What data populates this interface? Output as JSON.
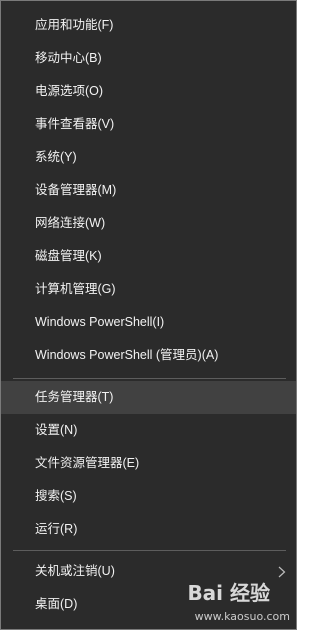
{
  "menu": {
    "group1": [
      {
        "label": "应用和功能(F)"
      },
      {
        "label": "移动中心(B)"
      },
      {
        "label": "电源选项(O)"
      },
      {
        "label": "事件查看器(V)"
      },
      {
        "label": "系统(Y)"
      },
      {
        "label": "设备管理器(M)"
      },
      {
        "label": "网络连接(W)"
      },
      {
        "label": "磁盘管理(K)"
      },
      {
        "label": "计算机管理(G)"
      },
      {
        "label": "Windows PowerShell(I)"
      },
      {
        "label": "Windows PowerShell (管理员)(A)"
      }
    ],
    "group2": [
      {
        "label": "任务管理器(T)",
        "highlighted": true
      },
      {
        "label": "设置(N)"
      },
      {
        "label": "文件资源管理器(E)"
      },
      {
        "label": "搜索(S)"
      },
      {
        "label": "运行(R)"
      }
    ],
    "group3": [
      {
        "label": "关机或注销(U)",
        "icon": "chevron-right-icon"
      },
      {
        "label": "桌面(D)"
      }
    ]
  },
  "watermark": {
    "logo": "Bai 经验",
    "url": "www.kaosuo.com"
  },
  "colors": {
    "background": "#2b2b2b",
    "highlight": "#414141",
    "text": "#f2f2f2",
    "separator": "#5d5d5d"
  }
}
